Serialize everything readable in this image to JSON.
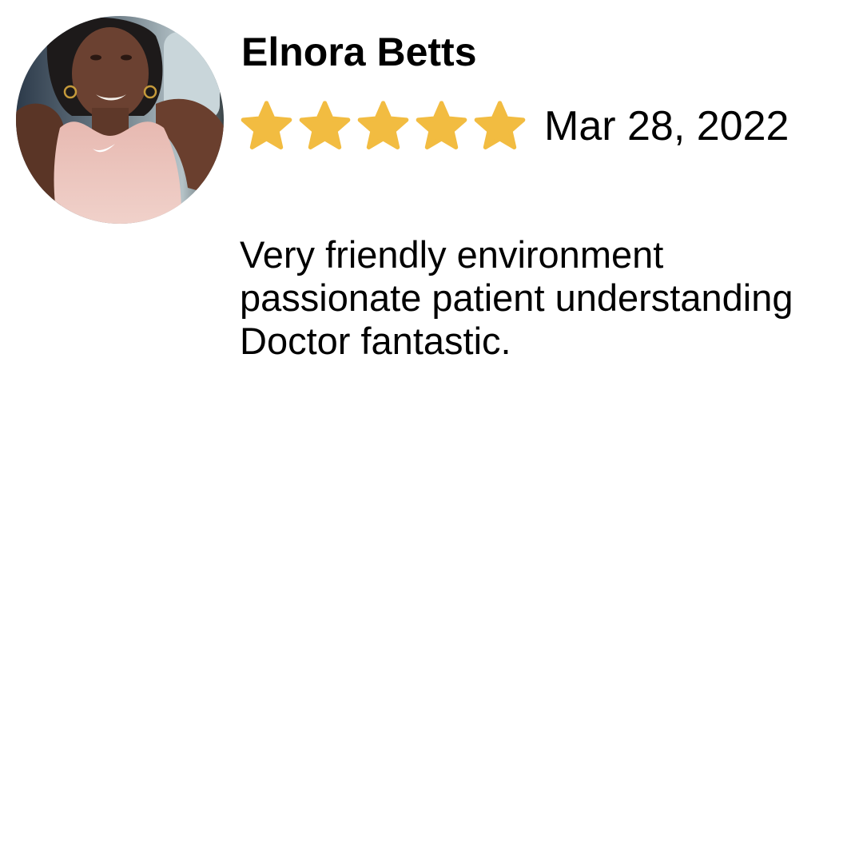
{
  "review": {
    "reviewer_name": "Elnora Betts",
    "rating": 5,
    "rating_max": 5,
    "date": "Mar 28, 2022",
    "text": "Very friendly environment passionate patient understanding Doctor fantastic."
  },
  "avatar": {
    "icon": "reviewer-photo"
  },
  "colors": {
    "star": "#F2BC41",
    "text": "#000000",
    "background": "#FFFFFF"
  }
}
